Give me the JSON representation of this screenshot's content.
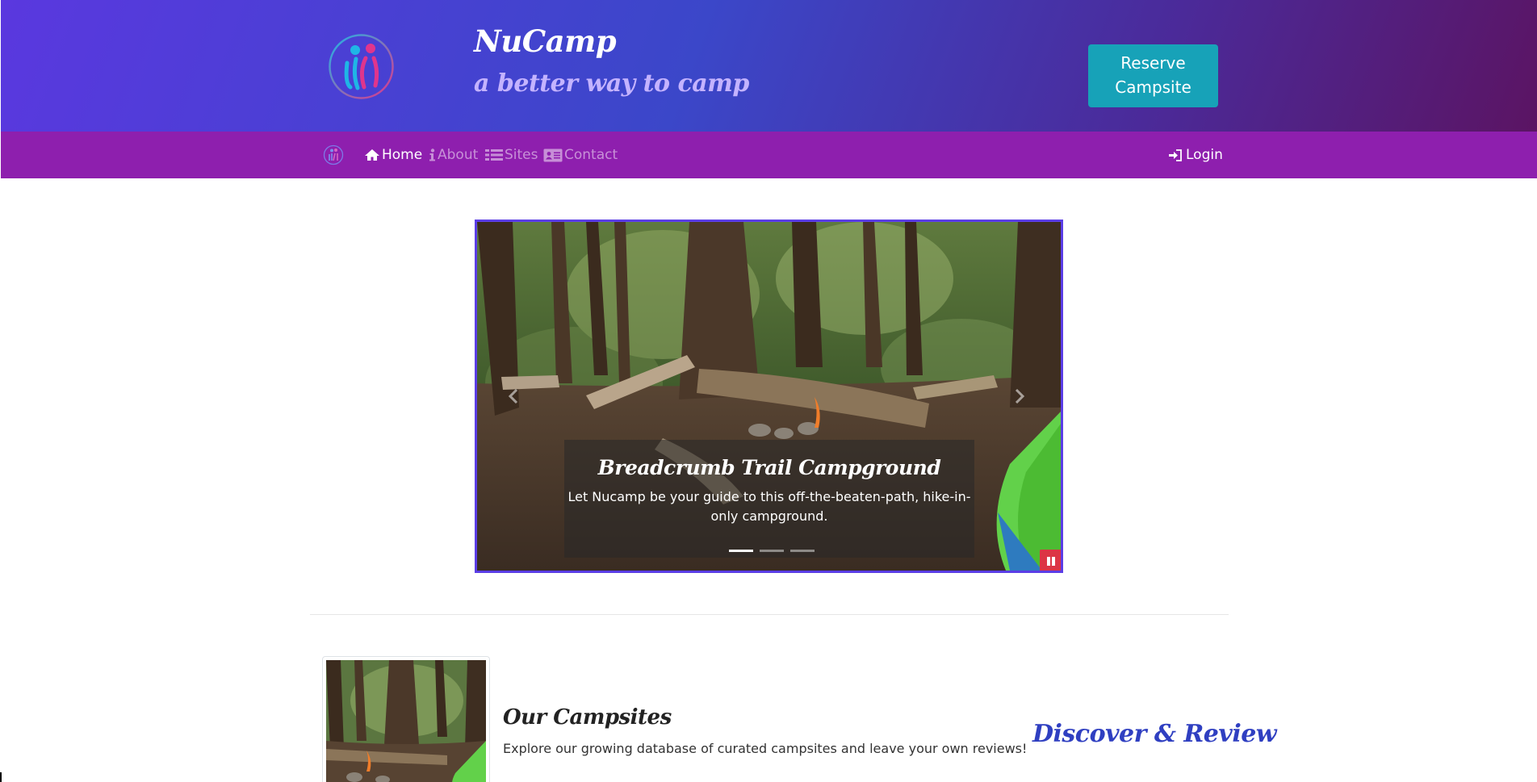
{
  "header": {
    "title": "NuCamp",
    "subtitle": "a better way to camp",
    "reserve_button": "Reserve Campsite",
    "logo_icon": "nucamp-logo-icon"
  },
  "nav": {
    "items": [
      {
        "label": "Home",
        "icon": "home-icon",
        "active": true
      },
      {
        "label": "About",
        "icon": "info-icon",
        "active": false
      },
      {
        "label": "Sites",
        "icon": "list-icon",
        "active": false
      },
      {
        "label": "Contact",
        "icon": "address-card-icon",
        "active": false
      }
    ],
    "login": "Login",
    "login_icon": "sign-in-icon"
  },
  "carousel": {
    "caption_title": "Breadcrumb Trail Campground",
    "caption_text": "Let Nucamp be your guide to this off-the-beaten-path, hike-in-only campground.",
    "slide_count": 3,
    "active_slide": 1
  },
  "feature": {
    "title": "Our Campsites",
    "text": "Explore our growing database of curated campsites and leave your own reviews!",
    "tagline": "Discover & Review"
  },
  "colors": {
    "header_gradient_start": "#5a38df",
    "header_gradient_end": "#5b1463",
    "nav_bg": "#8e1fae",
    "reserve_button": "#17a2b8",
    "carousel_border": "#5b3ee6",
    "pause_button": "#dc3545",
    "tagline": "#2f3fc1"
  }
}
